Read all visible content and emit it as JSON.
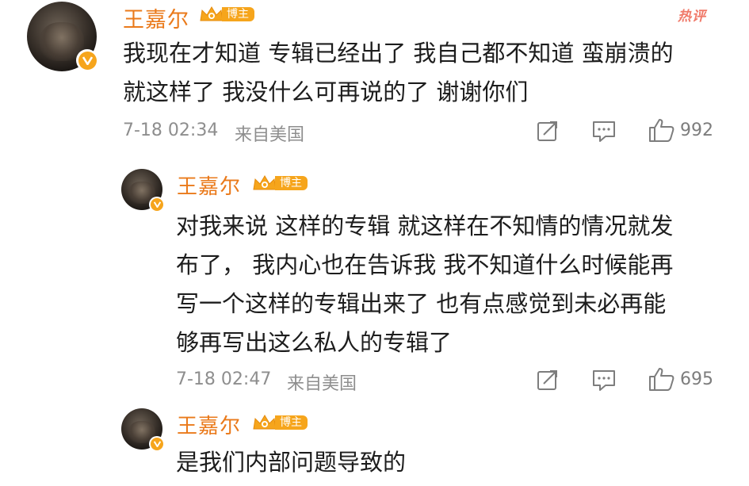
{
  "comments": [
    {
      "username": "王嘉尔",
      "badge_label": "博主",
      "hot_label": "热评",
      "lines": [
        "我现在才知道 专辑已经出了 我自己都不知道 蛮崩溃的",
        "就这样了 我没什么可再说的了  谢谢你们"
      ],
      "timestamp": "7-18 02:34",
      "source": "来自美国",
      "likes": "992"
    },
    {
      "username": "王嘉尔",
      "badge_label": "博主",
      "lines": [
        "对我来说 这样的专辑 就这样在不知情的情况就发",
        "布了，  我内心也在告诉我 我不知道什么时候能再",
        "写一个这样的专辑出来了 也有点感觉到未必再能",
        "够再写出这么私人的专辑了"
      ],
      "timestamp": "7-18 02:47",
      "source": "来自美国",
      "likes": "695"
    },
    {
      "username": "王嘉尔",
      "badge_label": "博主",
      "lines": [
        "是我们内部问题导致的"
      ]
    }
  ],
  "colors": {
    "username": "#ea7a1b",
    "badge": "#f6a51c",
    "hot": "#f07a6a",
    "meta": "#8e8e8e"
  },
  "icons": [
    "verified-v-icon",
    "crown-icon",
    "share-icon",
    "comment-icon",
    "like-icon"
  ]
}
